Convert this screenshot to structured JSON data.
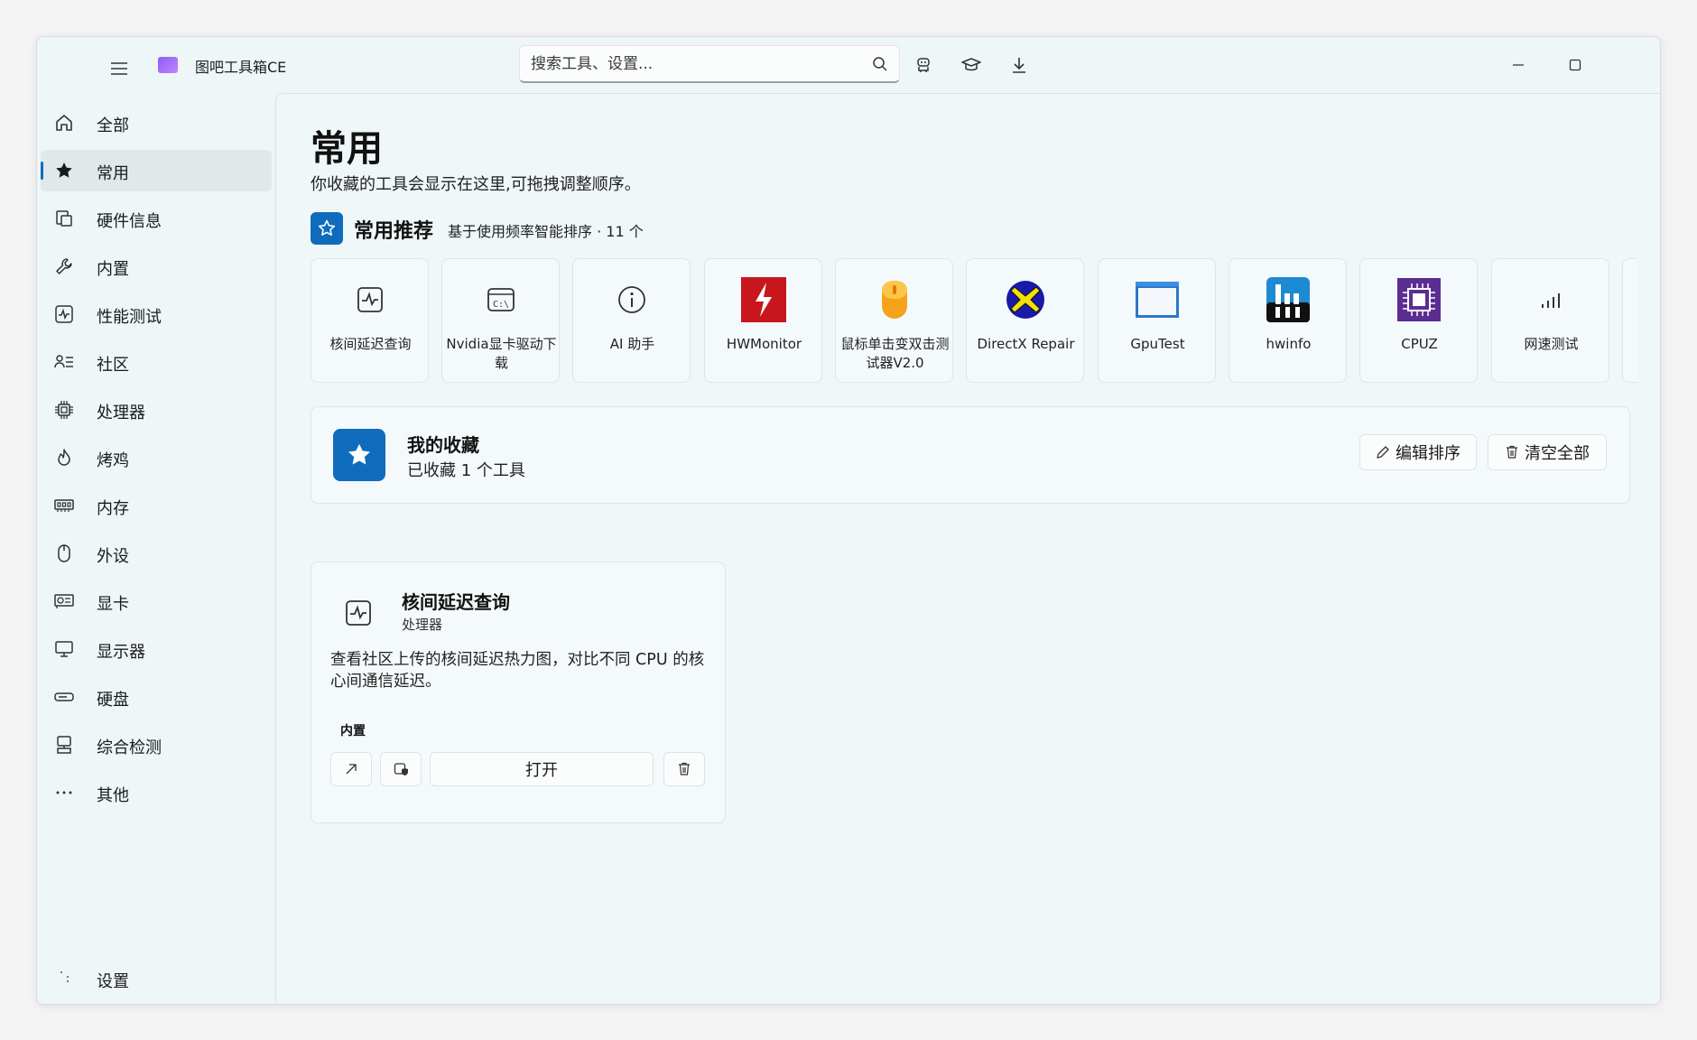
{
  "app": {
    "title": "图吧工具箱CE"
  },
  "search": {
    "placeholder": "搜索工具、设置..."
  },
  "sidebar": {
    "items": [
      {
        "label": "全部",
        "icon": "home-icon"
      },
      {
        "label": "常用",
        "icon": "star-icon",
        "active": true
      },
      {
        "label": "硬件信息",
        "icon": "hardware-icon"
      },
      {
        "label": "内置",
        "icon": "wrench-icon"
      },
      {
        "label": "性能测试",
        "icon": "pulse-icon"
      },
      {
        "label": "社区",
        "icon": "community-icon"
      },
      {
        "label": "处理器",
        "icon": "cpu-icon"
      },
      {
        "label": "烤鸡",
        "icon": "flame-icon"
      },
      {
        "label": "内存",
        "icon": "memory-icon"
      },
      {
        "label": "外设",
        "icon": "mouse-icon"
      },
      {
        "label": "显卡",
        "icon": "gpu-icon"
      },
      {
        "label": "显示器",
        "icon": "monitor-icon"
      },
      {
        "label": "硬盘",
        "icon": "disk-icon"
      },
      {
        "label": "综合检测",
        "icon": "diagnostics-icon"
      },
      {
        "label": "其他",
        "icon": "more-icon"
      }
    ],
    "settings_label": "设置"
  },
  "main": {
    "title": "常用",
    "subtitle": "你收藏的工具会显示在这里,可拖拽调整顺序。",
    "recommend": {
      "title": "常用推荐",
      "meta": "基于使用频率智能排序 · 11 个",
      "tiles": [
        {
          "label": "核间延迟查询",
          "icon": "pulse-icon"
        },
        {
          "label": "Nvidia显卡驱动下载",
          "icon": "terminal-window-icon"
        },
        {
          "label": "AI 助手",
          "icon": "info-icon"
        },
        {
          "label": "HWMonitor",
          "icon": "hwmonitor-logo-icon"
        },
        {
          "label": "鼠标单击变双击测试器V2.0",
          "icon": "mouse-logo-icon"
        },
        {
          "label": "DirectX Repair",
          "icon": "directx-logo-icon"
        },
        {
          "label": "GpuTest",
          "icon": "window-logo-icon"
        },
        {
          "label": "hwinfo",
          "icon": "hwinfo-logo-icon"
        },
        {
          "label": "CPUZ",
          "icon": "cpuz-logo-icon"
        },
        {
          "label": "网速测试",
          "icon": "signal-icon"
        }
      ]
    },
    "favorites": {
      "title": "我的收藏",
      "subtitle": "已收藏 1 个工具",
      "edit_label": "编辑排序",
      "clear_label": "清空全部"
    },
    "tool_card": {
      "title": "核间延迟查询",
      "category": "处理器",
      "description": "查看社区上传的核间延迟热力图，对比不同 CPU 的核心间通信延迟。",
      "tag": "内置",
      "open_label": "打开"
    }
  },
  "colors": {
    "accent": "#0f6cbd",
    "window_bg": "#eef6f7"
  }
}
